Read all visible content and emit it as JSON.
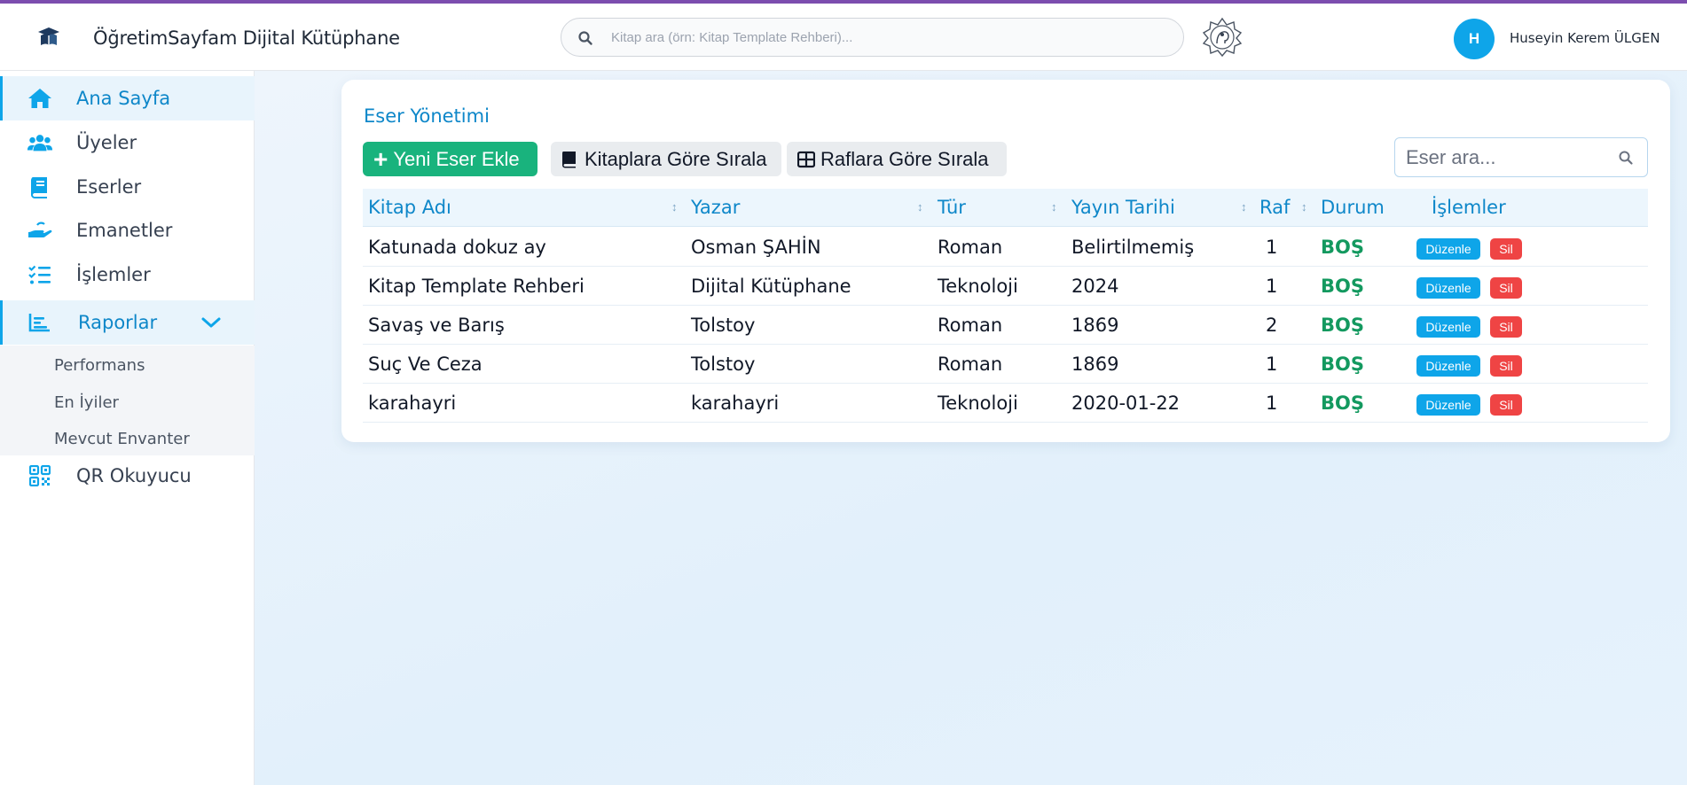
{
  "header": {
    "app_title": "ÖğretimSayfam Dijital Kütüphane",
    "search_placeholder": "Kitap ara (örn: Kitap Template Rehberi)...",
    "user": {
      "initial": "H",
      "name": "Huseyin Kerem ÜLGEN"
    }
  },
  "sidebar": {
    "items": [
      {
        "label": "Ana Sayfa",
        "icon": "home-icon"
      },
      {
        "label": "Üyeler",
        "icon": "users-icon"
      },
      {
        "label": "Eserler",
        "icon": "book-icon"
      },
      {
        "label": "Emanetler",
        "icon": "hand-icon"
      },
      {
        "label": "İşlemler",
        "icon": "list-check-icon"
      },
      {
        "label": "Raporlar",
        "icon": "chart-icon"
      },
      {
        "label": "QR Okuyucu",
        "icon": "qr-icon"
      }
    ],
    "submenu": [
      "Performans",
      "En İyiler",
      "Mevcut Envanter"
    ]
  },
  "main": {
    "title": "Eser Yönetimi",
    "add_button": "Yeni Eser Ekle",
    "sort_books_button": "Kitaplara Göre Sırala",
    "sort_shelves_button": "Raflara Göre Sırala",
    "search_placeholder": "Eser ara...",
    "columns": [
      "Kitap Adı",
      "Yazar",
      "Tür",
      "Yayın Tarihi",
      "Raf",
      "Durum",
      "İşlemler"
    ],
    "rows": [
      [
        "Katunada dokuz ay",
        "Osman ŞAHİN",
        "Roman",
        "Belirtilmemiş",
        "1",
        "BOŞ"
      ],
      [
        "Kitap Template Rehberi",
        "Dijital Kütüphane",
        "Teknoloji",
        "2024",
        "1",
        "BOŞ"
      ],
      [
        "Savaş ve Barış",
        "Tolstoy",
        "Roman",
        "1869",
        "2",
        "BOŞ"
      ],
      [
        "Suç Ve Ceza",
        "Tolstoy",
        "Roman",
        "1869",
        "1",
        "BOŞ"
      ],
      [
        "karahayri",
        "karahayri",
        "Teknoloji",
        "2020-01-22",
        "1",
        "BOŞ"
      ]
    ],
    "edit_label": "Düzenle",
    "delete_label": "Sil"
  },
  "colors": {
    "accent": "#0ea5e9",
    "success": "#19b37d",
    "danger": "#ef4444",
    "status_text": "#13995f",
    "top_bar": "#7c4daf"
  }
}
